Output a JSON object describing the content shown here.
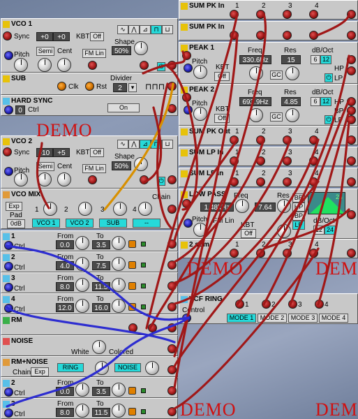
{
  "modules": {
    "vco1": {
      "title": "VCO 1",
      "sync": "Sync",
      "val1": "+0",
      "val2": "+0",
      "kbt": "KBT",
      "kbt_val": "Off",
      "pitch": "Pitch",
      "semi": "Semi",
      "cent": "Cent",
      "fm": "FM Lin",
      "shape": "Shape",
      "shape_val": "50%"
    },
    "sub": {
      "title": "SUB",
      "clk": "Clk",
      "rst": "Rst",
      "divider": "Divider",
      "div_val": "2"
    },
    "hardsync": {
      "title": "HARD SYNC",
      "ctrl": "Ctrl",
      "ctrl_val": "0",
      "on": "On"
    },
    "vco2": {
      "title": "VCO 2",
      "sync": "Sync",
      "val1": "-10",
      "val2": "+5",
      "kbt": "KBT",
      "kbt_val": "Off",
      "pitch": "Pitch",
      "semi": "Semi",
      "cent": "Cent",
      "fm": "FM Lin",
      "shape": "Shape",
      "shape_val": "50%"
    },
    "vcomix": {
      "title": "VCO MIX",
      "exp": "Exp",
      "pad": "Pad",
      "pad_val": "0dB",
      "chain": "Chain",
      "inputs": [
        "1",
        "2",
        "3",
        "4"
      ],
      "labels": [
        "VCO 1",
        "VCO 2",
        "SUB",
        "--"
      ]
    },
    "ctrls": [
      {
        "num": "1",
        "ctrl": "Ctrl",
        "from": "From",
        "to": "To",
        "from_val": "0.0",
        "to_val": "3.5"
      },
      {
        "num": "2",
        "ctrl": "Ctrl",
        "from": "From",
        "to": "To",
        "from_val": "4.0",
        "to_val": "7.5"
      },
      {
        "num": "3",
        "ctrl": "Ctrl",
        "from": "From",
        "to": "To",
        "from_val": "8.0",
        "to_val": "11.5"
      },
      {
        "num": "4",
        "ctrl": "Ctrl",
        "from": "From",
        "to": "To",
        "from_val": "12.0",
        "to_val": "16.0"
      }
    ],
    "rm": {
      "title": "RM"
    },
    "noise": {
      "title": "NOISE",
      "white": "White",
      "colored": "Colored"
    },
    "rmnoise": {
      "title": "RM+NOISE",
      "chain": "Chain",
      "exp": "Exp",
      "b1": "RING",
      "b2": "NOISE"
    },
    "ctrls2": [
      {
        "num": "2",
        "ctrl": "Ctrl",
        "from": "From",
        "to": "To",
        "from_val": "0.0",
        "to_val": "3.5"
      },
      {
        "num": "3",
        "ctrl": "Ctrl",
        "from": "From",
        "to": "To",
        "from_val": "8.0",
        "to_val": "11.5"
      }
    ],
    "sumpk1": {
      "title": "SUM PK In",
      "nums": [
        "1",
        "2",
        "3",
        "4"
      ]
    },
    "sumpk2": {
      "title": "SUM PK In"
    },
    "peak1": {
      "title": "PEAK 1",
      "pitch": "Pitch",
      "kbt": "KBT",
      "kbt_val": "Off",
      "freq": "Freq",
      "freq_val": "330.6Hz",
      "res": "Res",
      "res_val": "15",
      "gc": "GC",
      "db": "dB/Oct",
      "d1": "6",
      "d2": "12",
      "hp": "HP",
      "lp": "LP"
    },
    "peak2": {
      "title": "PEAK 2",
      "pitch": "Pitch",
      "kbt": "KBT",
      "kbt_val": "Off",
      "freq": "Freq",
      "freq_val": "693.9Hz",
      "res": "Res",
      "res_val": "4.85",
      "gc": "GC",
      "db": "dB/Oct",
      "d1": "6",
      "d2": "12",
      "hp": "HP",
      "bp": "BP",
      "lp": "LP"
    },
    "sumpkout": {
      "title": "SUM PK Out",
      "nums": [
        "1",
        "2",
        "3",
        "4"
      ]
    },
    "sumlp1": {
      "title": "SUM LP In",
      "nums": [
        "1",
        "2",
        "3",
        "4"
      ]
    },
    "sumlp2": {
      "title": "SUM LP In",
      "nums": [
        "1",
        "2",
        "3",
        "4"
      ]
    },
    "lowpass": {
      "title": "LOW PASS",
      "freq": "Freq",
      "freq_val": "1.48kHz",
      "res": "Res",
      "res_val": "7.64",
      "pitch": "Pitch",
      "fm": "FM Lin",
      "kbt": "KBT",
      "kbt_val": "Off",
      "br": "BR",
      "hp": "HP",
      "bp": "BP",
      "lp": "LP",
      "db": "dB/Oct",
      "d1": "12",
      "d2": "24",
      "slope": "24"
    },
    "sum2": {
      "title": "2 sum",
      "nums": [
        "1",
        "2",
        "3",
        "4"
      ]
    },
    "vcfring": {
      "title": "VCF RING",
      "control": "Control",
      "nums": [
        "1",
        "2",
        "3",
        "4"
      ],
      "modes": [
        "MODE 1",
        "MODE 2",
        "MODE 3",
        "MODE 4"
      ]
    }
  },
  "watermark": "DEMO",
  "colors": {
    "cable": "#a01818",
    "cable_blue": "#2d2dd0",
    "cable_orange": "#d89000",
    "panel": "#c8c8c8",
    "accent": "#26d9d9"
  }
}
